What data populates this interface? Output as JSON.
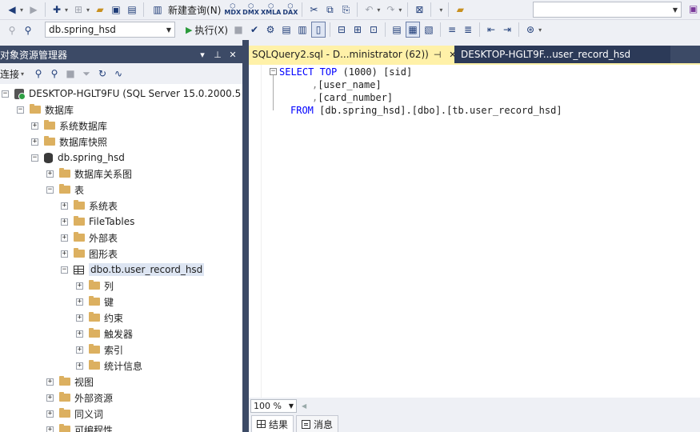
{
  "toolbar1": {
    "new_query_label": "新建查询(N)",
    "mini_labels": [
      "MDX",
      "DMX",
      "XMLA",
      "DAX"
    ],
    "search_value": ""
  },
  "toolbar2": {
    "database": "db.spring_hsd",
    "execute_label": "执行(X)"
  },
  "object_explorer": {
    "title": "对象资源管理器",
    "connect_label": "连接",
    "pin_glyph": "⊥",
    "close_glyph": "✕",
    "menu_glyph": "▾",
    "tree": [
      {
        "label": "DESKTOP-HGLT9FU (SQL Server 15.0.2000.5 - ",
        "expander": "−"
      },
      {
        "label": "数据库",
        "expander": "−"
      },
      {
        "label": "系统数据库",
        "expander": "+"
      },
      {
        "label": "数据库快照",
        "expander": "+"
      },
      {
        "label": "db.spring_hsd",
        "expander": "−"
      },
      {
        "label": "数据库关系图",
        "expander": "+"
      },
      {
        "label": "表",
        "expander": "−"
      },
      {
        "label": "系统表",
        "expander": "+"
      },
      {
        "label": "FileTables",
        "expander": "+"
      },
      {
        "label": "外部表",
        "expander": "+"
      },
      {
        "label": "图形表",
        "expander": "+"
      },
      {
        "label": "dbo.tb.user_record_hsd",
        "expander": "−"
      },
      {
        "label": "列",
        "expander": "+"
      },
      {
        "label": "键",
        "expander": "+"
      },
      {
        "label": "约束",
        "expander": "+"
      },
      {
        "label": "触发器",
        "expander": "+"
      },
      {
        "label": "索引",
        "expander": "+"
      },
      {
        "label": "统计信息",
        "expander": "+"
      },
      {
        "label": "视图",
        "expander": "+"
      },
      {
        "label": "外部资源",
        "expander": "+"
      },
      {
        "label": "同义词",
        "expander": "+"
      },
      {
        "label": "可编程性",
        "expander": "+"
      }
    ]
  },
  "tabs": {
    "active_label": "SQLQuery2.sql - D...ministrator (62))",
    "active_pin": "⊣",
    "active_close": "✕",
    "inactive_label": "DESKTOP-HGLT9F...user_record_hsd"
  },
  "editor": {
    "lines": [
      {
        "kw1": "SELECT",
        "kw2": "TOP",
        "rest": " (1000) [sid]"
      },
      {
        "comma": ",",
        "rest": "[user_name]"
      },
      {
        "comma": ",",
        "rest": "[card_number]"
      },
      {
        "kw1": "FROM",
        "rest": " [db.spring_hsd].[dbo].[tb.user_record_hsd]"
      }
    ]
  },
  "zoom": {
    "value": "100 %"
  },
  "results_tabs": {
    "results": "结果",
    "messages": "消息"
  }
}
